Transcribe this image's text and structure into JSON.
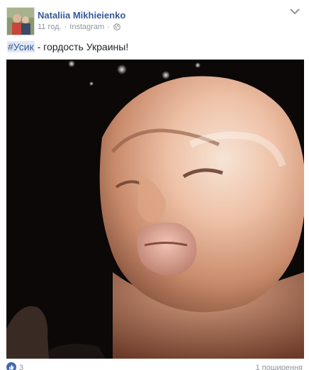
{
  "post": {
    "author": "Nataliia Mikhieienko",
    "time": "11 год.",
    "separator": "·",
    "source": "Instagram",
    "hashtag": "#Усик",
    "text": " - гордость Украины!",
    "reactions_count": "3",
    "shares": "1 поширення"
  },
  "icons": {
    "avatar": "profile-photo",
    "privacy": "globe-icon",
    "options": "chevron-down-icon",
    "like": "thumbs-up-icon"
  },
  "colors": {
    "link": "#365899",
    "meta": "#90949c",
    "hashtag_bg": "#e1e9f4",
    "like_blue": "#4267b2"
  }
}
